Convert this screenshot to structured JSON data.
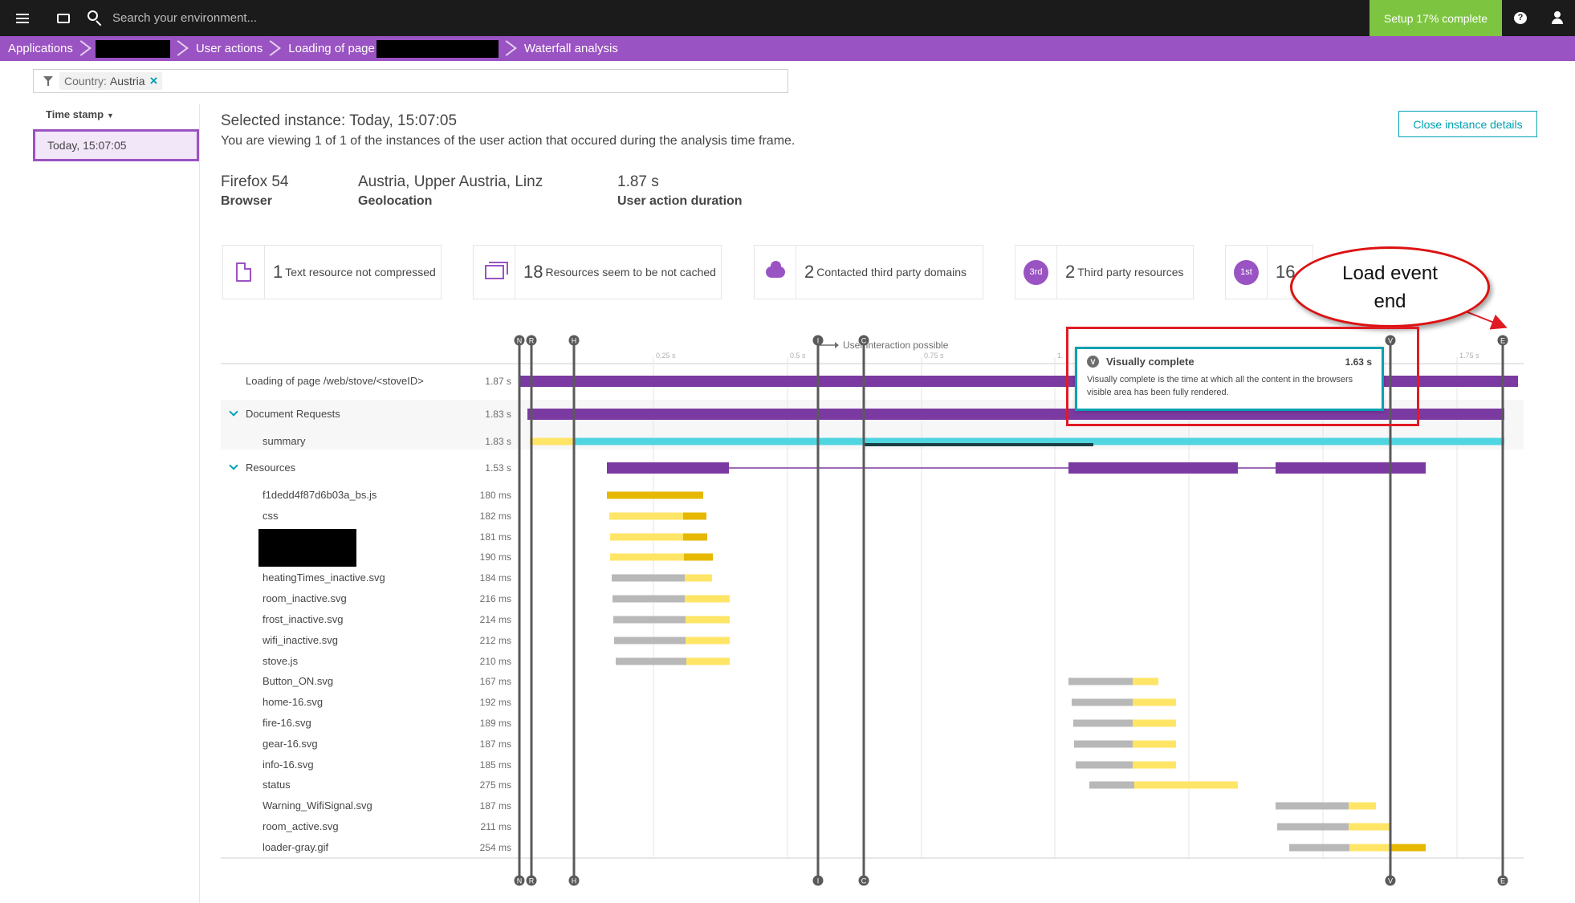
{
  "topbar": {
    "search_placeholder": "Search your environment...",
    "setup_label": "Setup 17% complete"
  },
  "breadcrumbs": [
    {
      "label": "Applications"
    },
    {
      "label": ""
    },
    {
      "label": "User actions"
    },
    {
      "label": "Loading of page"
    },
    {
      "label": "Waterfall analysis"
    }
  ],
  "filter": {
    "key": "Country:",
    "value": "Austria"
  },
  "timestamps": {
    "header": "Time stamp",
    "items": [
      "Today, 15:07:05"
    ]
  },
  "instance": {
    "title": "Selected instance: Today, 15:07:05",
    "subtitle": "You are viewing 1 of 1 of the instances of the user action that occured during the analysis time frame.",
    "close_label": "Close instance details",
    "browser_value": "Firefox 54",
    "browser_label": "Browser",
    "geo_value": "Austria, Upper Austria, Linz",
    "geo_label": "Geolocation",
    "duration_value": "1.87 s",
    "duration_label": "User action duration"
  },
  "cards": [
    {
      "icon": "document-icon",
      "num": "1",
      "text": "Text resource not compressed"
    },
    {
      "icon": "resources-icon",
      "num": "18",
      "text": "Resources seem to be not cached"
    },
    {
      "icon": "cloud-icon",
      "num": "2",
      "text": "Contacted third party domains"
    },
    {
      "icon": "third-party-badge-icon",
      "badge": "3rd",
      "num": "2",
      "text": "Third party resources"
    },
    {
      "icon": "first-party-badge-icon",
      "badge": "1st",
      "num": "16",
      "text": ""
    }
  ],
  "annotation": {
    "callout_line1": "Load event",
    "callout_line2": "end"
  },
  "waterfall": {
    "interaction_label": "User interaction possible",
    "ticks": [
      "0.25 s",
      "0.5 s",
      "0.75 s",
      "1.",
      "1.75 s"
    ],
    "markers": [
      "N",
      "R",
      "H",
      "I",
      "C",
      "V",
      "E"
    ],
    "rows": [
      {
        "label": "Loading of page /web/stove/<stoveID>",
        "dur": "1.87 s"
      },
      {
        "label": "Document Requests",
        "dur": "1.83 s"
      },
      {
        "label": "summary",
        "dur": "1.83 s"
      },
      {
        "label": "Resources",
        "dur": "1.53 s"
      },
      {
        "label": "f1dedd4f87d6b03a_bs.js",
        "dur": "180 ms"
      },
      {
        "label": "css",
        "dur": "182 ms"
      },
      {
        "label": "",
        "dur": "181 ms"
      },
      {
        "label": "",
        "dur": "190 ms"
      },
      {
        "label": "heatingTimes_inactive.svg",
        "dur": "184 ms"
      },
      {
        "label": "room_inactive.svg",
        "dur": "216 ms"
      },
      {
        "label": "frost_inactive.svg",
        "dur": "214 ms"
      },
      {
        "label": "wifi_inactive.svg",
        "dur": "212 ms"
      },
      {
        "label": "stove.js",
        "dur": "210 ms"
      },
      {
        "label": "Button_ON.svg",
        "dur": "167 ms"
      },
      {
        "label": "home-16.svg",
        "dur": "192 ms"
      },
      {
        "label": "fire-16.svg",
        "dur": "189 ms"
      },
      {
        "label": "gear-16.svg",
        "dur": "187 ms"
      },
      {
        "label": "info-16.svg",
        "dur": "185 ms"
      },
      {
        "label": "status",
        "dur": "275 ms"
      },
      {
        "label": "Warning_WifiSignal.svg",
        "dur": "187 ms"
      },
      {
        "label": "room_active.svg",
        "dur": "211 ms"
      },
      {
        "label": "loader-gray.gif",
        "dur": "254 ms"
      }
    ]
  },
  "tooltip": {
    "badge": "V",
    "title": "Visually complete",
    "time": "1.63 s",
    "body": "Visually complete is the time at which all the content in the browsers visible area has been fully rendered."
  },
  "colors": {
    "purple": "#7b3aa1",
    "cyan": "#4fd5e0",
    "yellow": "#ffe566",
    "gold": "#e6b800",
    "gray": "#b8b8b8",
    "accent": "#00a1b2",
    "highlight_red": "#e01b24"
  }
}
